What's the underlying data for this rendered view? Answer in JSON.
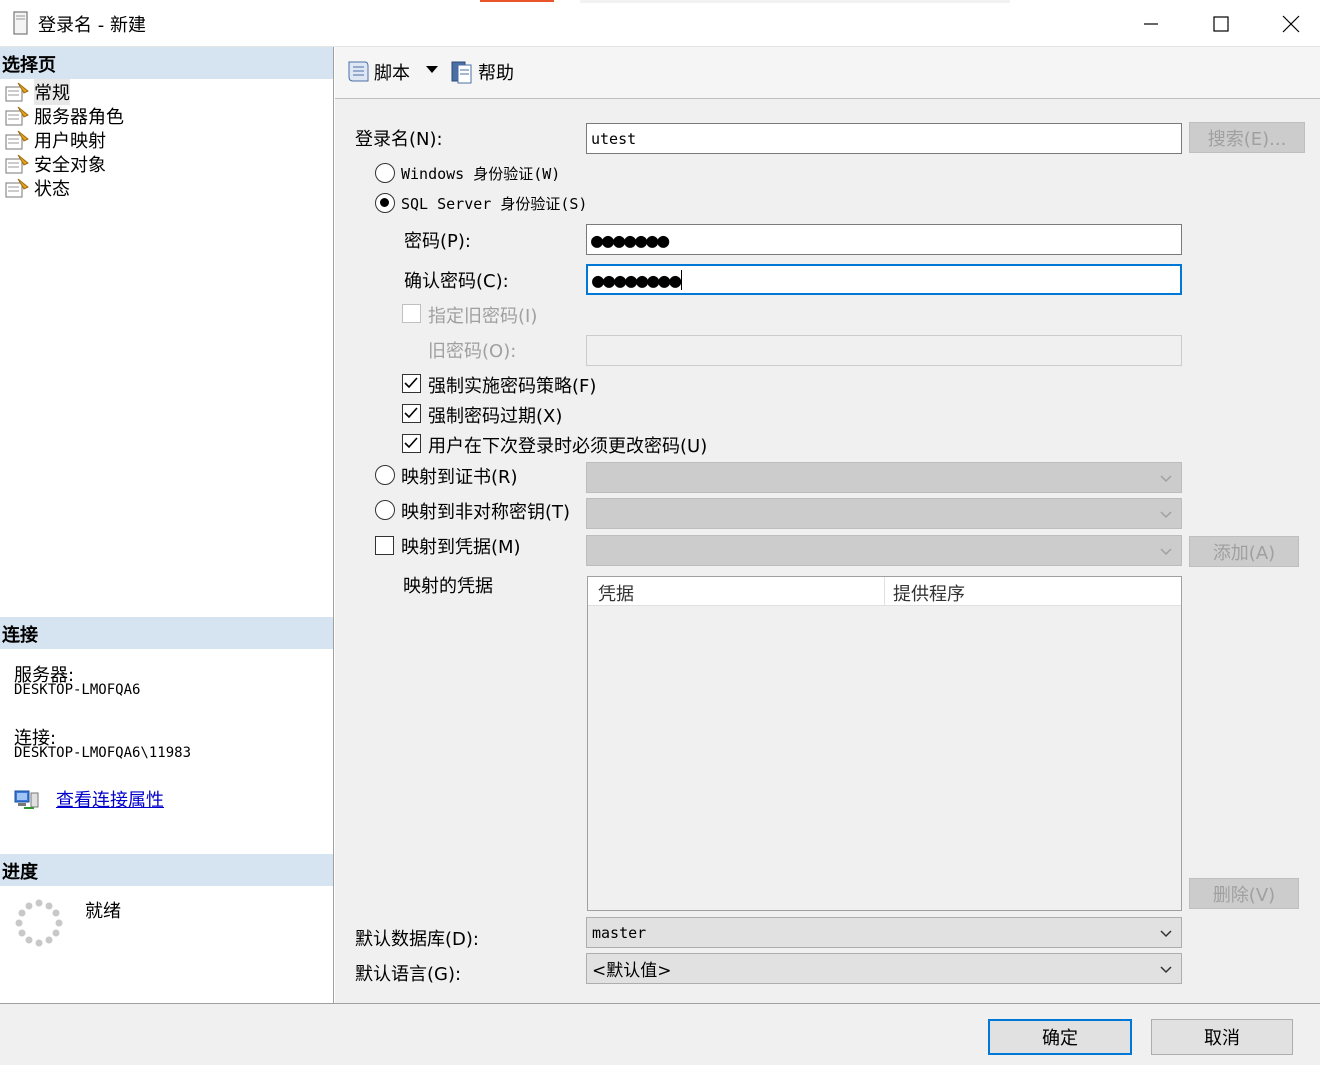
{
  "window": {
    "title": "登录名 - 新建"
  },
  "left": {
    "select_page_header": "选择页",
    "pages": [
      {
        "label": "常规"
      },
      {
        "label": "服务器角色"
      },
      {
        "label": "用户映射"
      },
      {
        "label": "安全对象"
      },
      {
        "label": "状态"
      }
    ],
    "connection_header": "连接",
    "server_label": "服务器:",
    "server_value": "DESKTOP-LMOFQA6",
    "connection_label": "连接:",
    "connection_value": "DESKTOP-LMOFQA6\\11983",
    "view_props_link": "查看连接属性",
    "progress_header": "进度",
    "progress_status": "就绪"
  },
  "toolbar": {
    "script_label": "脚本",
    "help_label": "帮助"
  },
  "form": {
    "login_name_label": "登录名(N):",
    "login_name_value": "utest",
    "search_button": "搜索(E)...",
    "windows_auth_label": "Windows 身份验证(W)",
    "sql_auth_label": "SQL Server 身份验证(S)",
    "password_label": "密码(P):",
    "password_value": "●●●●●●●",
    "confirm_password_label": "确认密码(C):",
    "confirm_password_value": "●●●●●●●●",
    "specify_old_password_label": "指定旧密码(I)",
    "old_password_label": "旧密码(O):",
    "enforce_policy_label": "强制实施密码策略(F)",
    "enforce_expiration_label": "强制密码过期(X)",
    "must_change_label": "用户在下次登录时必须更改密码(U)",
    "map_certificate_label": "映射到证书(R)",
    "map_asym_key_label": "映射到非对称密钥(T)",
    "map_credential_label": "映射到凭据(M)",
    "add_button": "添加(A)",
    "mapped_credentials_label": "映射的凭据",
    "grid_columns": [
      "凭据",
      "提供程序"
    ],
    "delete_button": "删除(V)",
    "default_db_label": "默认数据库(D):",
    "default_db_value": "master",
    "default_lang_label": "默认语言(G):",
    "default_lang_value": "<默认值>"
  },
  "buttons": {
    "ok": "确定",
    "cancel": "取消"
  },
  "colors": {
    "section_header_bg": "#d6e4f2",
    "focus_border": "#0078d7",
    "link": "#0000cc"
  }
}
